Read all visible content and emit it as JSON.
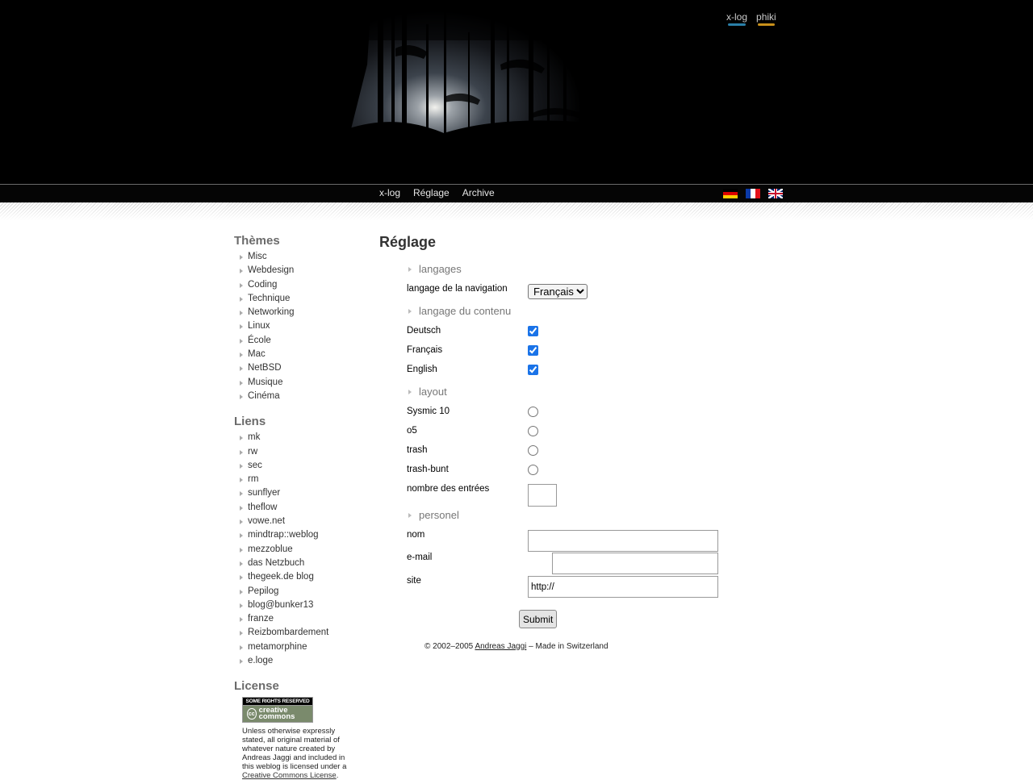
{
  "top_links": [
    "x-log",
    "phiki"
  ],
  "nav": {
    "items": [
      "x-log",
      "Réglage",
      "Archive"
    ]
  },
  "sidebar": {
    "themes_title": "Thèmes",
    "themes": [
      "Misc",
      "Webdesign",
      "Coding",
      "Technique",
      "Networking",
      "Linux",
      "École",
      "Mac",
      "NetBSD",
      "Musique",
      "Cinéma"
    ],
    "links_title": "Liens",
    "links": [
      "mk",
      "rw",
      "sec",
      "rm",
      "sunflyer",
      "theflow",
      "vowe.net",
      "mindtrap::weblog",
      "mezzoblue",
      "das Netzbuch",
      "thegeek.de blog",
      "Pepilog",
      "blog@bunker13",
      "franze",
      "Reizbombardement",
      "metamorphine",
      "e.loge"
    ],
    "license_title": "License",
    "license_badge_top": "SOME RIGHTS RESERVED",
    "license_badge_main": "creative commons",
    "license_text": "Unless otherwise expressly stated, all original material of whatever nature created by Andreas Jaggi and included in this weblog is licensed under a",
    "license_link": "Creative Commons License",
    "license_end": "."
  },
  "main": {
    "title": "Réglage",
    "section_langages": "langages",
    "nav_lang_label": "langage de la navigation",
    "nav_lang_value": "Français",
    "section_content_lang": "langage du contenu",
    "content_langs": [
      {
        "label": "Deutsch",
        "checked": true
      },
      {
        "label": "Français",
        "checked": true
      },
      {
        "label": "English",
        "checked": true
      }
    ],
    "section_layout": "layout",
    "layouts": [
      "Sysmic 10",
      "o5",
      "trash",
      "trash-bunt"
    ],
    "entries_label": "nombre des entrées",
    "entries_value": "",
    "section_personel": "personel",
    "name_label": "nom",
    "name_value": "",
    "email_label": "e-mail",
    "email_value": "",
    "site_label": "site",
    "site_value": "http://",
    "submit_label": "Submit",
    "footer_prefix": "© 2002–2005",
    "footer_author": "Andreas Jaggi",
    "footer_suffix": "– Made in Switzerland"
  }
}
